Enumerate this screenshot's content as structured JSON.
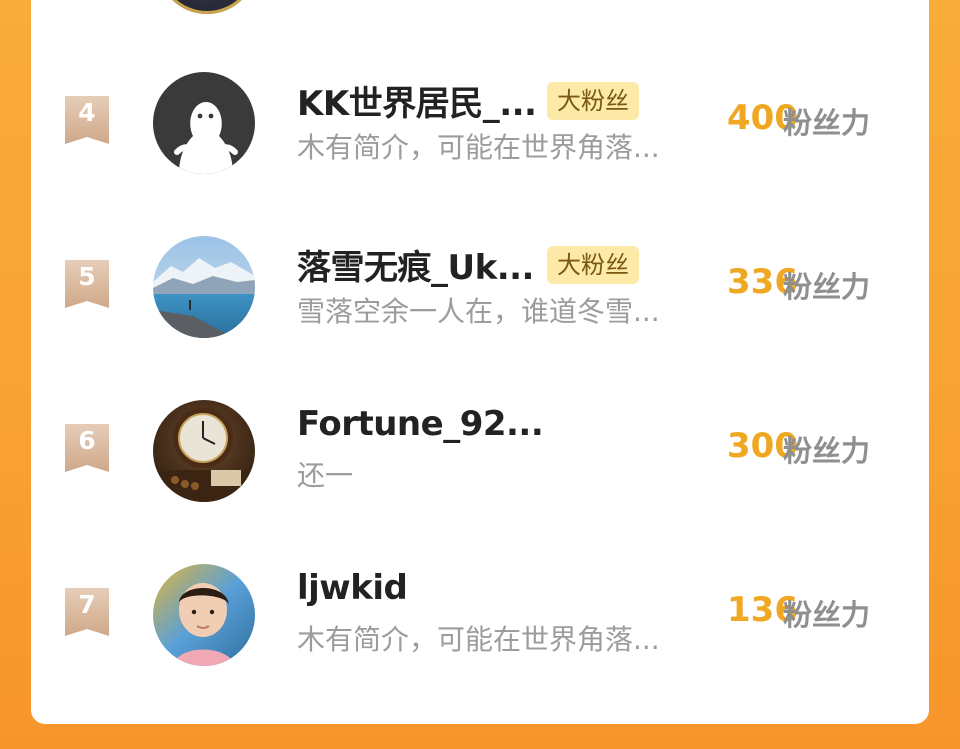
{
  "colors": {
    "background": "#f8a233",
    "card": "#ffffff",
    "score": "#f0a722",
    "badge_bg": "#fde9a8",
    "rank_ribbon": "#d8b79b"
  },
  "rows": [
    {
      "rank": "4",
      "name": "KK世界居民_...",
      "badge": "大粉丝",
      "bio": "木有简介，可能在世界角落...",
      "score": "400",
      "unit": "粉丝力",
      "avatar_icon": "default-person-avatar"
    },
    {
      "rank": "5",
      "name": "落雪无痕_Uk...",
      "badge": "大粉丝",
      "bio": "雪落空余一人在，谁道冬雪...",
      "score": "336",
      "unit": "粉丝力",
      "avatar_icon": "snow-mountain-lake-avatar"
    },
    {
      "rank": "6",
      "name": "Fortune_92...",
      "badge": "",
      "bio": "还一",
      "score": "300",
      "unit": "粉丝力",
      "avatar_icon": "clock-avatar"
    },
    {
      "rank": "7",
      "name": "ljwkid",
      "badge": "",
      "bio": "木有简介，可能在世界角落...",
      "score": "136",
      "unit": "粉丝力",
      "avatar_icon": "child-photo-avatar"
    }
  ]
}
